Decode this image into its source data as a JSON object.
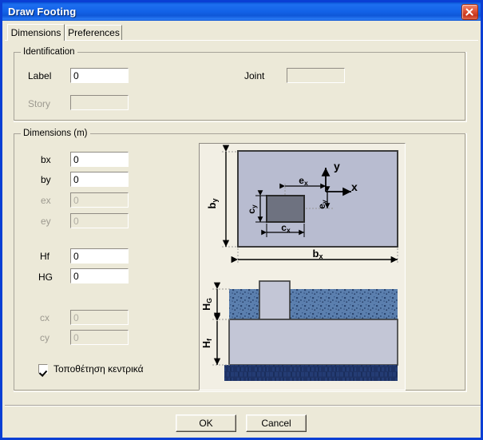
{
  "window": {
    "title": "Draw Footing",
    "close_icon": "close-icon",
    "accent_color": "#0a56d6",
    "face_color": "#ece9d8"
  },
  "tabs": [
    {
      "label": "Dimensions",
      "active": true
    },
    {
      "label": "Preferences",
      "active": false
    }
  ],
  "identification": {
    "title": "Identification",
    "fields": [
      {
        "label": "Label",
        "value": "0",
        "enabled": true
      },
      {
        "label": "Story",
        "value": "",
        "enabled": false
      },
      {
        "label": "Joint",
        "value": "",
        "enabled": false
      }
    ]
  },
  "dimensions": {
    "title": "Dimensions (m)",
    "fields": [
      {
        "label": "bx",
        "value": "0",
        "enabled": true
      },
      {
        "label": "by",
        "value": "0",
        "enabled": true
      },
      {
        "label": "ex",
        "value": "0",
        "enabled": false
      },
      {
        "label": "ey",
        "value": "0",
        "enabled": false
      },
      {
        "label": "Hf",
        "value": "0",
        "enabled": true
      },
      {
        "label": "HG",
        "value": "0",
        "enabled": true
      },
      {
        "label": "cx",
        "value": "0",
        "enabled": false
      },
      {
        "label": "cy",
        "value": "0",
        "enabled": false
      }
    ],
    "checkbox": {
      "label": "Τοποθέτηση κεντρικά",
      "checked": true
    }
  },
  "diagram": {
    "plan": {
      "footing_fill": "#b8bcd0",
      "column_fill": "#6e7280",
      "labels": {
        "by": "b",
        "by_sub": "y",
        "bx": "b",
        "bx_sub": "x",
        "cx": "c",
        "cx_sub": "x",
        "cy": "c",
        "cy_sub": "y",
        "ex": "e",
        "ex_sub": "x",
        "ey": "e",
        "ey_sub": "y",
        "axis_x": "x",
        "axis_y": "y"
      }
    },
    "section": {
      "soil_fill": "#5b7fae",
      "concrete_fill": "#c3c6d6",
      "bedrock_fill": "#1e3264",
      "labels": {
        "hg": "H",
        "hg_sub": "G",
        "hf": "H",
        "hf_sub": "f"
      }
    }
  },
  "footer": {
    "ok_label": "OK",
    "cancel_label": "Cancel"
  }
}
